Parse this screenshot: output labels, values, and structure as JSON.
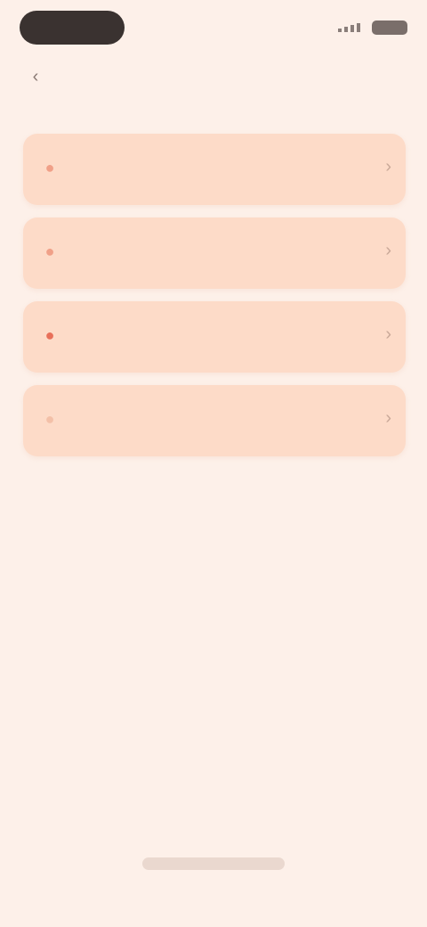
{
  "status_bar": {
    "time": "",
    "signal_icon": "signal-icon",
    "battery_icon": "battery-icon"
  },
  "header": {
    "back_icon": "chevron-left-icon",
    "title": "",
    "subtitle": ""
  },
  "items": [
    {
      "title": "",
      "description": "",
      "icon": "alert-icon",
      "icon_color": "#f0a088"
    },
    {
      "title": "",
      "description": "",
      "icon": "alert-icon",
      "icon_color": "#f0a088"
    },
    {
      "title": "",
      "description": "",
      "icon": "alert-icon",
      "icon_color": "#e8705a"
    },
    {
      "title": "",
      "description": "",
      "icon": "alert-icon",
      "icon_color": "#f3c0a8"
    }
  ],
  "colors": {
    "background": "#fdf0e9",
    "card": "#fddbc8",
    "accent": "#e8705a"
  }
}
